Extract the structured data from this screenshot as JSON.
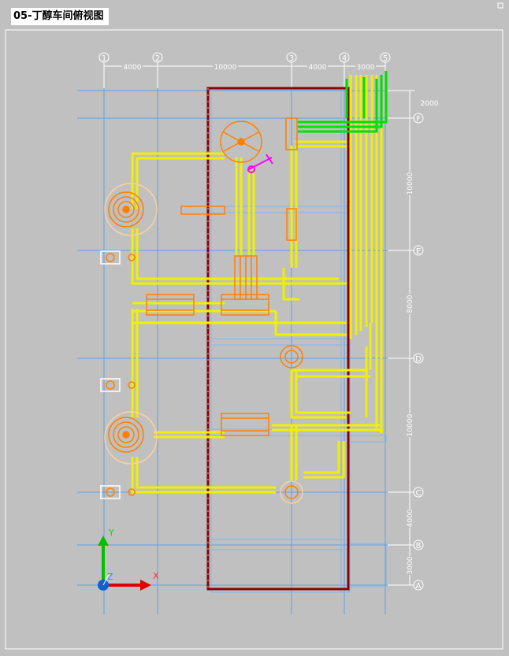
{
  "title": "05-丁醇车间俯视图",
  "axes": {
    "columns": [
      "1",
      "2",
      "3",
      "4",
      "5"
    ],
    "rows": [
      "F",
      "E",
      "D",
      "C",
      "B",
      "A"
    ]
  },
  "dimensions": {
    "top": [
      "4000",
      "10000",
      "4000",
      "3000"
    ],
    "right": [
      "2000",
      "10000",
      "8000",
      "10000",
      "4000",
      "3000"
    ]
  },
  "ucs": {
    "x_label": "X",
    "y_label": "Y",
    "z_label": "Z"
  },
  "colors": {
    "background": "#c0c0c0",
    "grid": "#5ea0e8",
    "pipe": "#f0f000",
    "equipment": "#ff8000",
    "boundary": "#8b0000",
    "green_pipe": "#00e000",
    "magenta": "#ff00ff"
  }
}
